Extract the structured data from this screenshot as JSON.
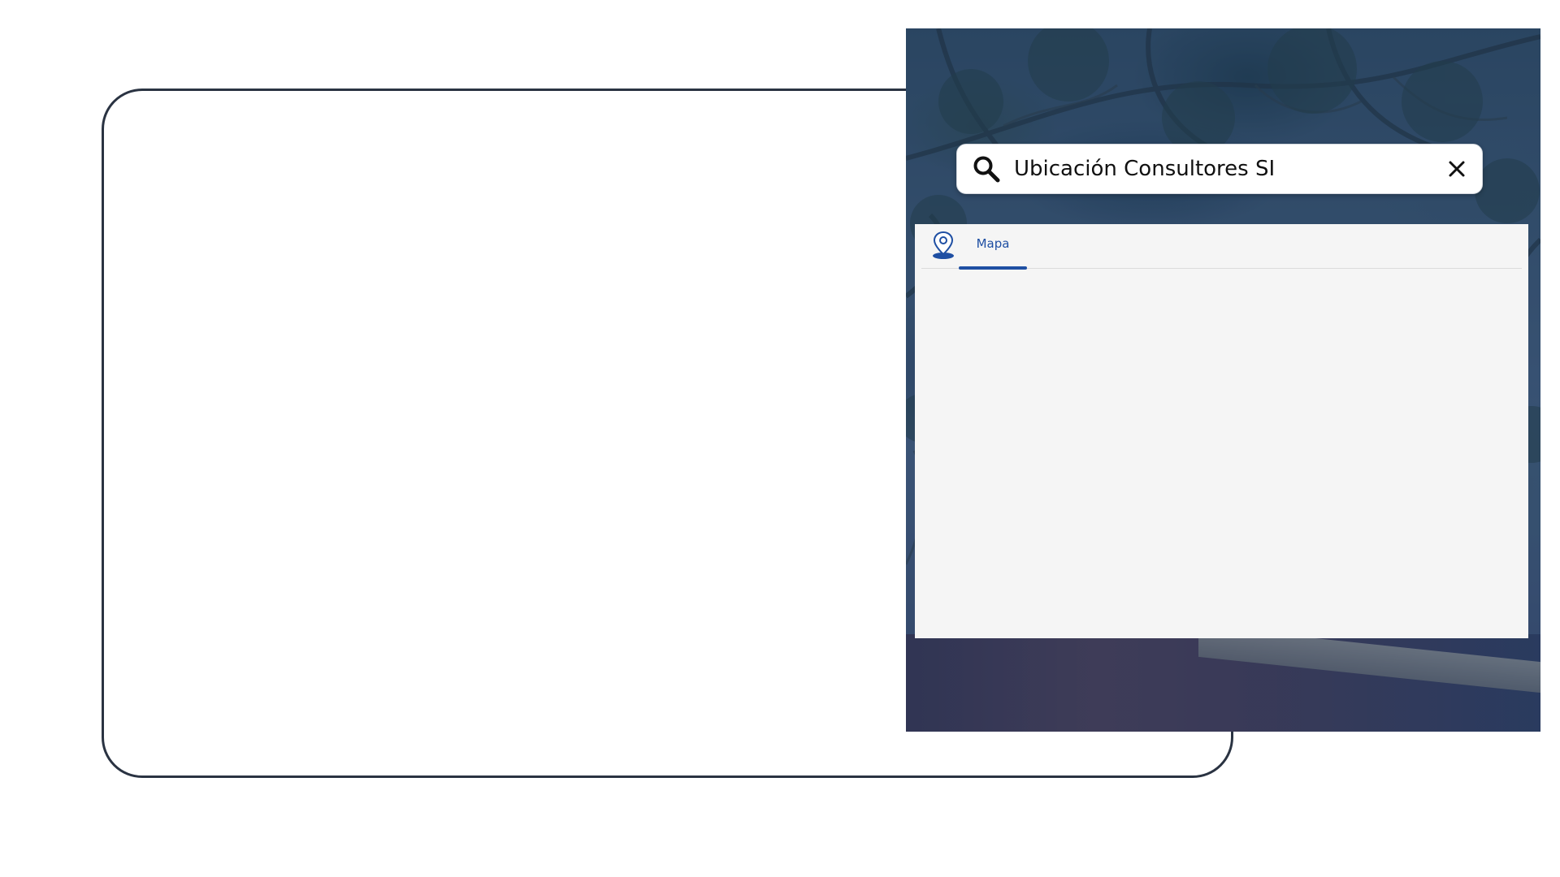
{
  "search": {
    "value": "Ubicación Consultores SI",
    "icon": "search-icon",
    "clear_icon": "close-icon"
  },
  "tabs": [
    {
      "label": "Mapa",
      "icon": "map-pin-icon",
      "active": true
    }
  ],
  "colors": {
    "accent": "#1f4fa3",
    "outline": "#2a3342",
    "panel_bg": "#f5f5f5",
    "photo_tint": "#142d5f"
  }
}
